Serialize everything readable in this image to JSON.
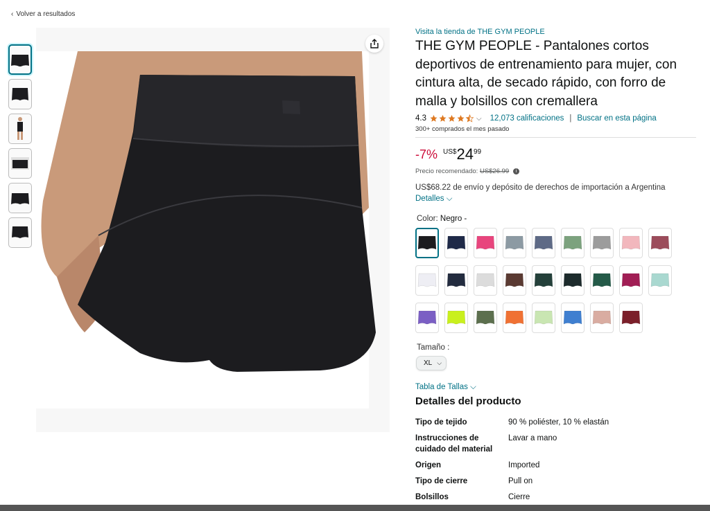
{
  "nav": {
    "back_label": "Volver a resultados"
  },
  "product": {
    "store_link": "Visita la tienda de THE GYM PEOPLE",
    "title": "THE GYM PEOPLE - Pantalones cortos deportivos de entrenamiento para mujer, con cintura alta, de secado rápido, con forro de malla y bolsillos con cremallera",
    "rating": "4.3",
    "rating_fraction": 0.86,
    "ratings_count": "12,073 calificaciones",
    "search_page": "Buscar en esta página",
    "bought": "300+ comprados el mes pasado"
  },
  "price": {
    "discount": "-7%",
    "currency": "US$",
    "whole": "24",
    "cents": "99",
    "list_price_label": "Precio recomendado:",
    "list_price": "US$26.99"
  },
  "shipping": {
    "text": "US$68.22 de envío y depósito de derechos de importación a Argentina",
    "details_link": "Detalles"
  },
  "color": {
    "label": "Color:",
    "selected": "Negro -",
    "swatches": [
      {
        "name": "black",
        "hex": "#1c1c1f"
      },
      {
        "name": "navy",
        "hex": "#1f2a48"
      },
      {
        "name": "pink",
        "hex": "#e8457d"
      },
      {
        "name": "grey-blue",
        "hex": "#8c9aa3"
      },
      {
        "name": "slate",
        "hex": "#5e6a86"
      },
      {
        "name": "sage",
        "hex": "#7ca27e"
      },
      {
        "name": "grey",
        "hex": "#9c9c9c"
      },
      {
        "name": "light-pink",
        "hex": "#f2b7bd"
      },
      {
        "name": "mauve",
        "hex": "#9c4c5b"
      },
      {
        "name": "white",
        "hex": "#eeeef4"
      },
      {
        "name": "dark-navy",
        "hex": "#232c3f"
      },
      {
        "name": "light-grey",
        "hex": "#dcdcdc"
      },
      {
        "name": "brown",
        "hex": "#5a3a32"
      },
      {
        "name": "dark-green",
        "hex": "#24403a"
      },
      {
        "name": "black-green",
        "hex": "#1d2b2c"
      },
      {
        "name": "forest",
        "hex": "#245a48"
      },
      {
        "name": "magenta",
        "hex": "#a11e55"
      },
      {
        "name": "mint",
        "hex": "#a9d8d0"
      },
      {
        "name": "purple",
        "hex": "#7b5fc4"
      },
      {
        "name": "neon",
        "hex": "#c9f01d"
      },
      {
        "name": "olive",
        "hex": "#5c6f4e"
      },
      {
        "name": "orange",
        "hex": "#f07133"
      },
      {
        "name": "pale-green",
        "hex": "#c9e6b2"
      },
      {
        "name": "blue",
        "hex": "#3f7fd0"
      },
      {
        "name": "nude",
        "hex": "#d9aca1"
      },
      {
        "name": "burgundy",
        "hex": "#7b1f2a"
      }
    ]
  },
  "size": {
    "label": "Tamaño :",
    "selected": "XL"
  },
  "size_chart_link": "Tabla de Tallas",
  "details": {
    "title": "Detalles del producto",
    "rows": [
      {
        "k": "Tipo de tejido",
        "v": "90 % poliéster, 10 % elastán"
      },
      {
        "k": "Instrucciones de cuidado del material",
        "v": "Lavar a mano"
      },
      {
        "k": "Origen",
        "v": "Imported"
      },
      {
        "k": "Tipo de cierre",
        "v": "Pull on"
      },
      {
        "k": "Bolsillos",
        "v": "Cierre"
      }
    ]
  },
  "colors": {
    "link": "#007185",
    "discount": "#cc0c39",
    "star": "#de7921"
  }
}
